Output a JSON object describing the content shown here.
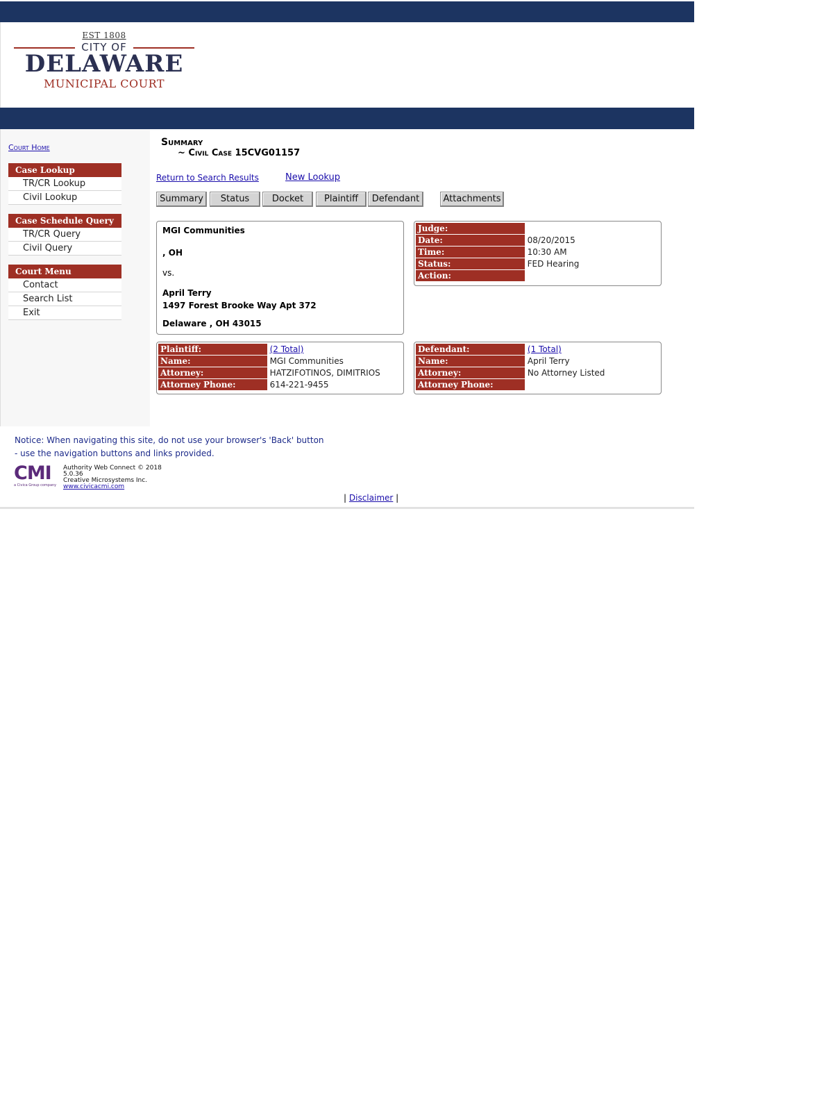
{
  "header": {
    "logo_est": "EST 1808",
    "logo_city": "CITY OF",
    "logo_name": "DELAWARE",
    "logo_court": "MUNICIPAL COURT"
  },
  "sidebar": {
    "court_home": "Court Home",
    "groups": [
      {
        "title": "Case Lookup",
        "items": [
          "TR/CR Lookup",
          "Civil Lookup"
        ]
      },
      {
        "title": "Case Schedule Query",
        "items": [
          "TR/CR Query",
          "Civil Query"
        ]
      },
      {
        "title": "Court Menu",
        "items": [
          "Contact",
          "Search List",
          "Exit"
        ]
      }
    ]
  },
  "main": {
    "title": "Summary",
    "subtitle": "~ Civil Case 15CVG01157",
    "return_link": "Return to Search Results",
    "new_lookup_link": "New Lookup",
    "tabs": [
      "Summary",
      "Status",
      "Docket",
      "Plaintiff",
      "Defendant",
      "Attachments"
    ]
  },
  "parties": {
    "plaintiff_name": "MGI Communities",
    "plaintiff_location": ", OH",
    "vs": "vs.",
    "defendant_name": "April Terry",
    "defendant_street": "1497 Forest Brooke Way Apt 372",
    "defendant_city": "Delaware , OH 43015"
  },
  "schedule": {
    "judge_label": "Judge:",
    "judge": "",
    "date_label": "Date:",
    "date": "08/20/2015",
    "time_label": "Time:",
    "time": "10:30 AM",
    "status_label": "Status:",
    "status": "FED Hearing",
    "action_label": "Action:",
    "action": ""
  },
  "plaintiff_box": {
    "header_label": "Plaintiff:",
    "total": "(2 Total)",
    "name_label": "Name:",
    "name": "MGI Communities",
    "attorney_label": "Attorney:",
    "attorney": "HATZIFOTINOS, DIMITRIOS",
    "phone_label": "Attorney Phone:",
    "phone": "614-221-9455"
  },
  "defendant_box": {
    "header_label": "Defendant:",
    "total": "(1 Total)",
    "name_label": "Name:",
    "name": "April Terry",
    "attorney_label": "Attorney:",
    "attorney": "No Attorney Listed",
    "phone_label": "Attorney Phone:",
    "phone": ""
  },
  "footer": {
    "notice_line1": "Notice: When navigating this site, do not use your browser's 'Back' button",
    "notice_line2": "- use the navigation buttons and links provided.",
    "cmi_logo": "CMI",
    "cmi_tagline": "a Civica Group company",
    "product": "Authority Web Connect © 2018",
    "version": "5.0.36",
    "company": "Creative Microsystems Inc.",
    "website": "www.civicacmi.com",
    "disclaimer_prefix": "|",
    "disclaimer": "Disclaimer",
    "disclaimer_suffix": "|"
  },
  "colors": {
    "navy": "#1c3461",
    "brick": "#9e2f24",
    "cmi_purple": "#5b2a7a"
  }
}
